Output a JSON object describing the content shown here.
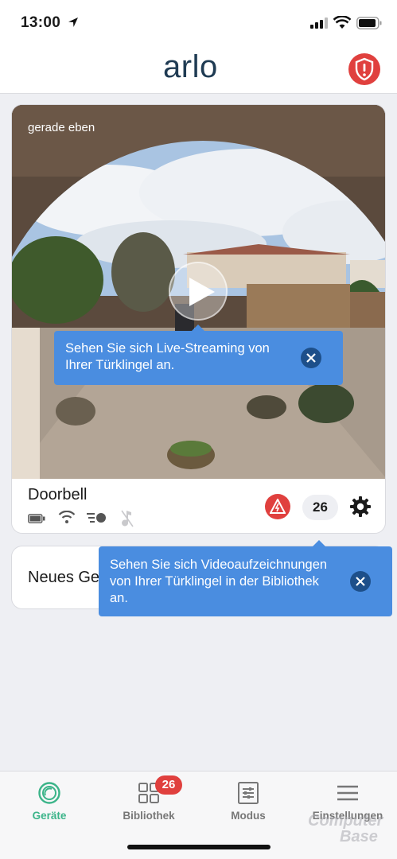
{
  "status_bar": {
    "time": "13:00"
  },
  "header": {
    "logo": "arlo"
  },
  "camera_card": {
    "timestamp": "gerade eben",
    "device_name": "Doorbell",
    "recordings_count": "26"
  },
  "tooltips": {
    "live": "Sehen Sie sich Live-Streaming von Ihrer Türklingel an.",
    "library": "Sehen Sie sich Videoaufzeichnungen von Ihrer Türklingel in der Bibliothek an."
  },
  "second_card": {
    "label": "Neues Ge"
  },
  "tabbar": {
    "tabs": [
      {
        "label": "Geräte",
        "icon": "devices-icon"
      },
      {
        "label": "Bibliothek",
        "icon": "library-icon"
      },
      {
        "label": "Modus",
        "icon": "mode-icon"
      },
      {
        "label": "Einstellungen",
        "icon": "menu-icon"
      }
    ],
    "library_badge": "26"
  },
  "watermark": {
    "line1": "Computer",
    "line2": "Base"
  },
  "colors": {
    "accent_green": "#3bb489",
    "tooltip_blue": "#4a8de0",
    "alert_red": "#e0403e",
    "logo_navy": "#1f3b53"
  }
}
